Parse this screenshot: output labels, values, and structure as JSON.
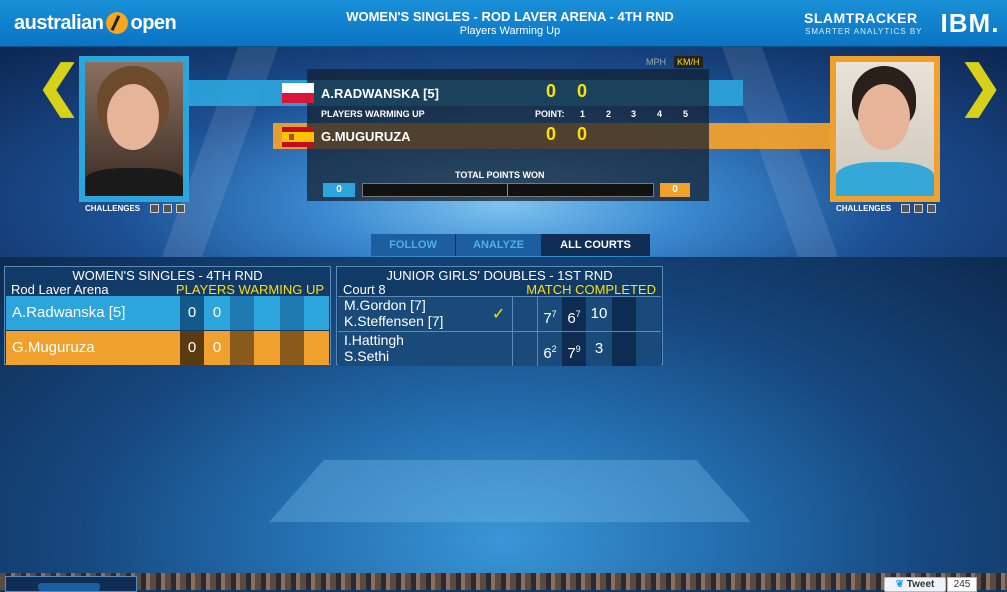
{
  "header": {
    "logo_left": "australian",
    "logo_right": "open",
    "title": "WOMEN'S SINGLES - ROD LAVER ARENA - 4TH RND",
    "subtitle": "Players Warming Up",
    "slamtracker": "SLAMTRACKER",
    "slamtracker_sub": "SMARTER ANALYTICS BY",
    "ibm": "IBM."
  },
  "match": {
    "unit_mph": "MPH",
    "unit_kmh": "KM/H",
    "player1": {
      "name": "A.RADWANSKA [5]",
      "sets": "0",
      "games": "0",
      "color": "#2ca4dc"
    },
    "player2": {
      "name": "G.MUGURUZA",
      "sets": "0",
      "games": "0",
      "color": "#f0a02c"
    },
    "status": "PLAYERS WARMING UP",
    "point_label": "POINT:",
    "set_numbers": [
      "1",
      "2",
      "3",
      "4",
      "5"
    ],
    "total_points_label": "TOTAL POINTS WON",
    "total_points_p1": "0",
    "total_points_p2": "0",
    "challenges_label": "CHALLENGES",
    "accent": "#ffe000"
  },
  "tabs": [
    {
      "label": "FOLLOW"
    },
    {
      "label": "ANALYZE"
    },
    {
      "label": "ALL COURTS"
    }
  ],
  "courts": [
    {
      "title": "WOMEN'S SINGLES - 4TH RND",
      "court": "Rod Laver Arena",
      "status": "PLAYERS WARMING UP",
      "rows": [
        {
          "name": "A.Radwanska [5]",
          "scores": [
            "0",
            "0"
          ]
        },
        {
          "name": "G.Muguruza",
          "scores": [
            "0",
            "0"
          ]
        }
      ]
    },
    {
      "title": "JUNIOR GIRLS' DOUBLES - 1ST RND",
      "court": "Court 8",
      "status": "MATCH COMPLETED",
      "rows": [
        {
          "name1": "M.Gordon [7]",
          "name2": "K.Steffensen [7]",
          "winner": true,
          "sets": [
            {
              "v": "7",
              "tb": "7"
            },
            {
              "v": "6",
              "tb": "7"
            },
            {
              "v": "10",
              "tb": ""
            }
          ]
        },
        {
          "name1": "I.Hattingh",
          "name2": "S.Sethi",
          "winner": false,
          "sets": [
            {
              "v": "6",
              "tb": "2"
            },
            {
              "v": "7",
              "tb": "9"
            },
            {
              "v": "3",
              "tb": ""
            }
          ]
        }
      ]
    }
  ],
  "social": {
    "tweet": "Tweet",
    "count": "245"
  }
}
